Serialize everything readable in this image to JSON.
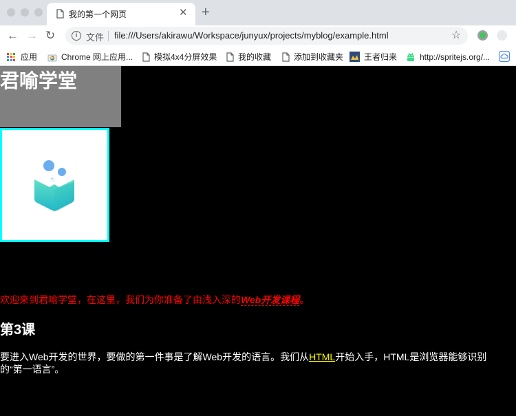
{
  "browser": {
    "tab_title": "我的第一个网页",
    "tab_close": "✕",
    "new_tab": "+",
    "address_scheme_label": "文件",
    "url": "file:///Users/akirawu/Workspace/junyux/projects/myblog/example.html"
  },
  "bookmarks": [
    {
      "label": "应用",
      "icon": "apps-grid-icon"
    },
    {
      "label": "Chrome 网上应用...",
      "icon": "chrome-webstore-icon"
    },
    {
      "label": "模拟4x4分屏效果",
      "icon": "page-icon"
    },
    {
      "label": "我的收藏",
      "icon": "page-icon"
    },
    {
      "label": "添加到收藏夹",
      "icon": "page-icon"
    },
    {
      "label": "王者归来",
      "icon": "image-favicon-icon"
    },
    {
      "label": "http://spritejs.org/...",
      "icon": "android-icon"
    }
  ],
  "page": {
    "site_title": "君喻学堂",
    "welcome_prefix": "欢迎来到君喻学堂，在这里，我们为你准备了由浅入深的",
    "welcome_emphasis": "Web开发课程",
    "welcome_suffix": "。",
    "lesson_heading": "第3课",
    "para_prefix": "要进入Web开发的世界，要做的第一件事是了解Web开发的语言。我们从",
    "para_link": "HTML",
    "para_suffix": "开始入手，HTML是浏览器能够识别的“第一语言”。"
  },
  "colors": {
    "page_bg": "#000000",
    "title_box": "#808080",
    "image_border": "#00ffff",
    "welcome_text": "#ff0000",
    "link": "#ffff00",
    "logo_gradient_top": "#4fd6c2",
    "logo_gradient_bottom": "#27c1c7",
    "logo_dots": "#6aaef0"
  }
}
